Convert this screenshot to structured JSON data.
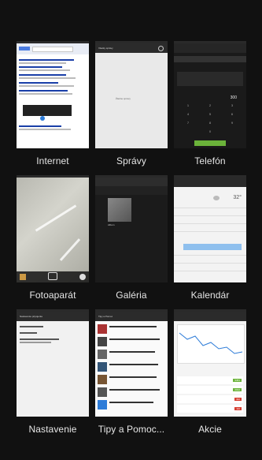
{
  "apps": [
    {
      "id": "internet",
      "label": "Internet"
    },
    {
      "id": "spravy",
      "label": "Správy"
    },
    {
      "id": "telefon",
      "label": "Telefón"
    },
    {
      "id": "fotoaparat",
      "label": "Fotoaparát"
    },
    {
      "id": "galeria",
      "label": "Galéria"
    },
    {
      "id": "kalendar",
      "label": "Kalendár"
    },
    {
      "id": "nastavenie",
      "label": "Nastavenie"
    },
    {
      "id": "tipy",
      "label": "Tipy a Pomoc..."
    },
    {
      "id": "akcie",
      "label": "Akcie"
    }
  ],
  "thumbs": {
    "spravy_title": "Všetky správy",
    "spravy_empty": "Žiadne správy",
    "telefon_number": "300",
    "kalendar_temp": "32°",
    "nastavenie_title": "Nastavenie pripojenia",
    "tipy_title": "Tipy a Pomoc",
    "akcie_values": [
      "3451",
      "2012",
      "432",
      "110"
    ]
  },
  "colors": {
    "background": "#111111",
    "label": "#e6e6e6",
    "accent_green": "#6bb33a",
    "accent_blue": "#2c7bd8",
    "stock_red": "#d63c2f"
  }
}
